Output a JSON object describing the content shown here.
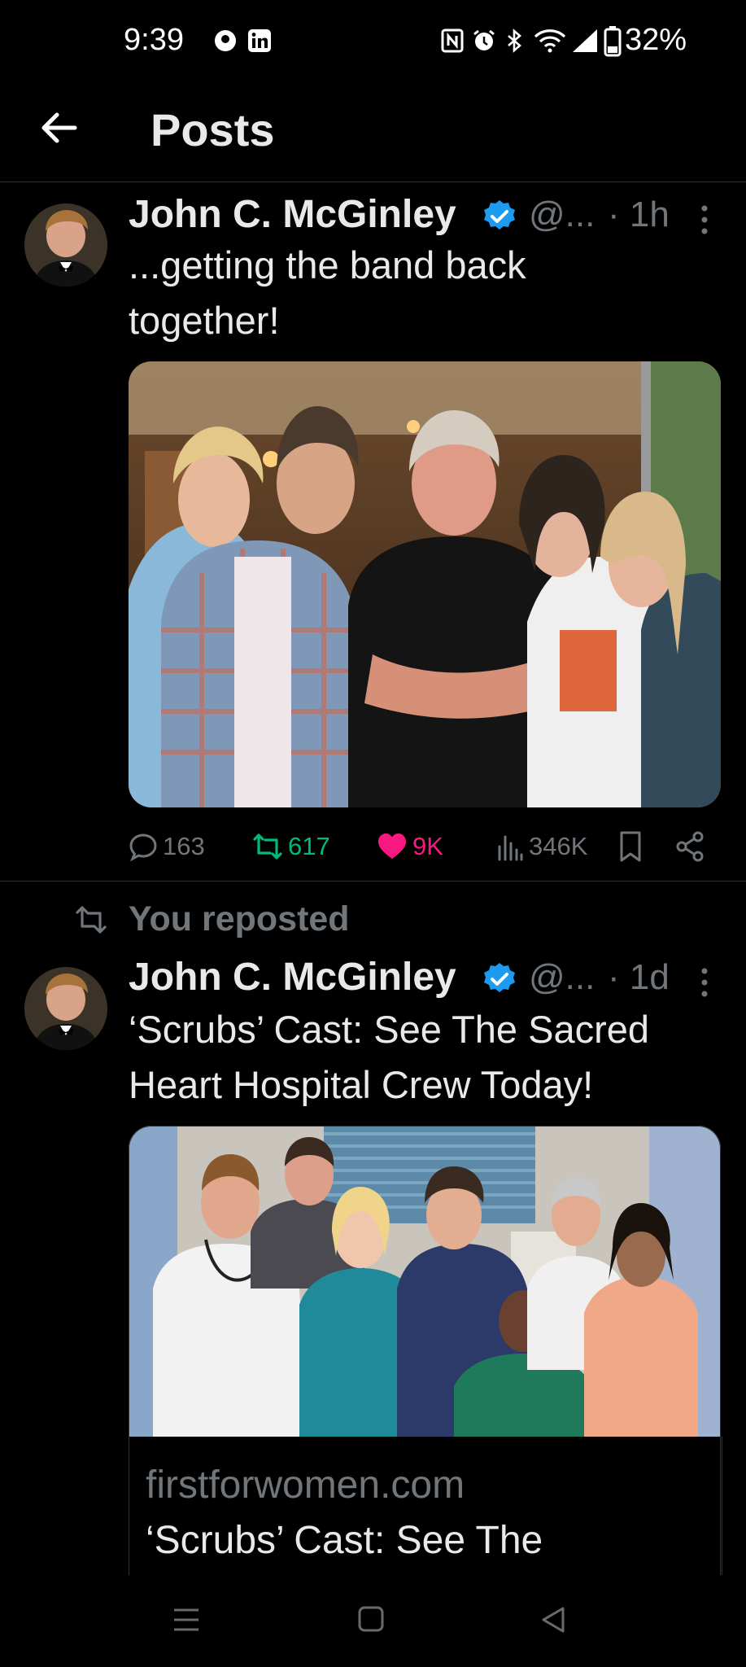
{
  "status_bar": {
    "time": "9:39",
    "battery": "32%",
    "icons": [
      "notification-circle-icon",
      "linkedin-icon",
      "nfc-icon",
      "alarm-icon",
      "bluetooth-icon",
      "wifi-icon",
      "signal-icon",
      "battery-icon"
    ]
  },
  "header": {
    "back_icon": "arrow-left-icon",
    "title": "Posts"
  },
  "posts": [
    {
      "author": "John C. McGinley",
      "handle": "@...",
      "time": "· 1h",
      "text_line1": "...getting the band back",
      "text_line2": "together!",
      "stats": {
        "replies": "163",
        "reposts": "617",
        "likes": "9K",
        "views": "346K"
      },
      "repost_color": "#00ba7c",
      "like_color": "#f91880"
    },
    {
      "repost_label": "You reposted",
      "author": "John C. McGinley",
      "handle": "@...",
      "time": "· 1d",
      "text_line1": "‘Scrubs’ Cast: See The Sacred",
      "text_line2": "Heart Hospital Crew Today!",
      "card": {
        "domain": "firstforwomen.com",
        "title": "‘Scrubs’ Cast: See The"
      }
    }
  ],
  "nav_bar": {
    "icons": [
      "menu-icon",
      "home-square-icon",
      "back-triangle-icon"
    ]
  },
  "colors": {
    "verified": "#1d9bf0",
    "muted": "#71767b",
    "text": "#e7e9ea"
  }
}
